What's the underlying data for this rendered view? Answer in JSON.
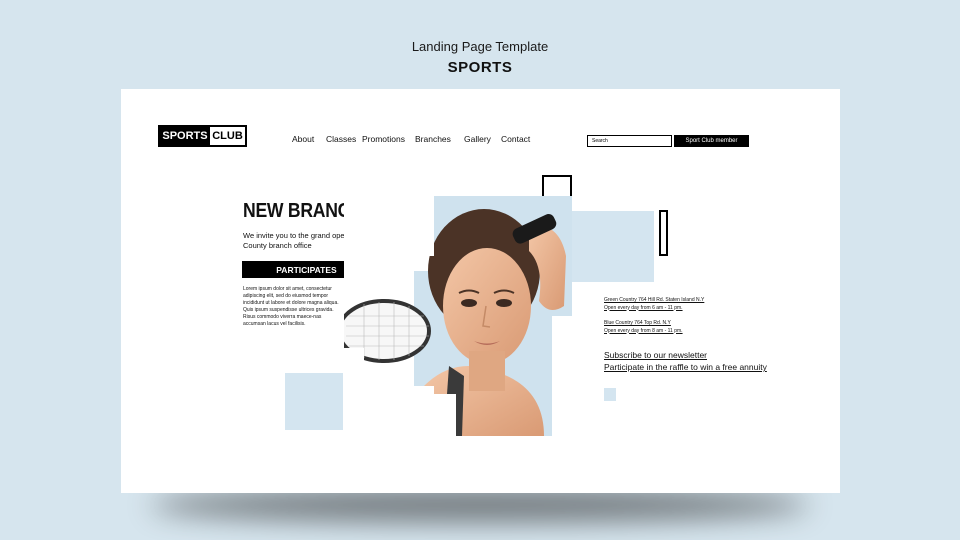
{
  "header": {
    "title": "Landing Page Template",
    "subtitle": "SPORTS"
  },
  "logo": {
    "part1": "SPORTS",
    "part2": "CLUB"
  },
  "nav": {
    "items": [
      "About",
      "Classes",
      "Promotions",
      "Branches",
      "Gallery",
      "Contact"
    ]
  },
  "search": {
    "placeholder": "Search"
  },
  "member_button": "Sport Club member",
  "hero": {
    "title": "NEW BRANCH",
    "intro": "We invite you to the grand opening of the Blue County branch office",
    "cta": "PARTICIPATES",
    "body": "Lorem ipsum dolor sit amet, consectetur adipiscing elit, sed do eiusmod tempor incididunt ut labore et dolore magna aliqua. Quis ipsum suspendisse ultrices gravida. Risus commodo viverra maece-nas accumsan lacus vel facilisis."
  },
  "addresses": [
    {
      "line1": "Green Country 764 Hill Rd. Staten Island N.Y",
      "line2": "Open every day from 6 am - 11 pm."
    },
    {
      "line1": "Blue Country 764 Top Rd. N.Y",
      "line2": "Open every day from 8 am - 11 pm."
    }
  ],
  "links": {
    "newsletter": "Subscribe to our newsletter",
    "raffle": "Participate in the raffle to win a free annuity"
  },
  "colors": {
    "background": "#d6e5ee",
    "accent_blue": "#d4e5f0",
    "black": "#000000"
  }
}
